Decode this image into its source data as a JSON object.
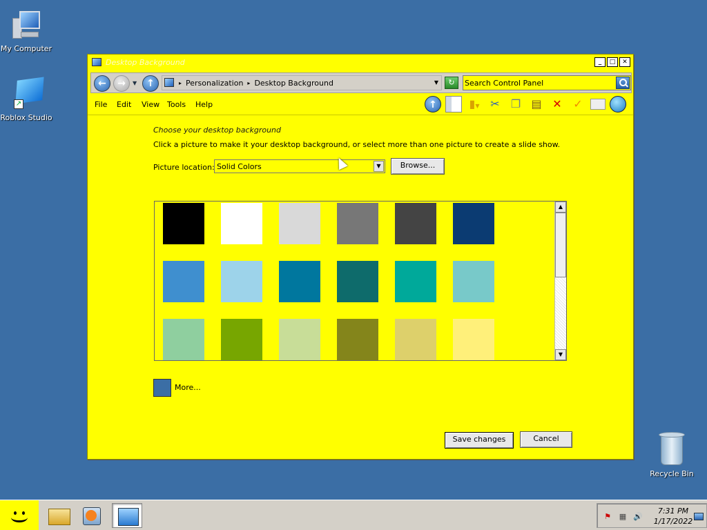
{
  "desktop": {
    "icons": [
      {
        "label": "My Computer"
      },
      {
        "label": "Roblox Studio"
      },
      {
        "label": "Recycle Bin"
      }
    ]
  },
  "window": {
    "title": "Desktop Background",
    "controls": {
      "minimize": "_",
      "maximize": "□",
      "close": "✕"
    },
    "address": {
      "crumbs": [
        "Personalization",
        "Desktop Background"
      ]
    },
    "search": {
      "value": "Search Control Panel"
    },
    "menu": [
      "File",
      "Edit",
      "View",
      "Tools",
      "Help"
    ],
    "toolbar_icons": [
      "up-icon",
      "panes-icon",
      "folders-icon",
      "cut-icon",
      "copy-icon",
      "paste-icon",
      "delete-icon",
      "check-icon",
      "properties-icon",
      "views-icon"
    ]
  },
  "content": {
    "heading": "Choose your desktop background",
    "description": "Click a picture to make it your desktop background, or select more than one picture to create a slide show.",
    "location_label": "Picture location:",
    "location_value": "Solid Colors",
    "browse_label": "Browse...",
    "swatches": [
      "#000000",
      "#ffffff",
      "#d9d9d9",
      "#777777",
      "#444444",
      "#0b3b72",
      "#3f8fcf",
      "#9dd3ea",
      "#00779e",
      "#0e6b6b",
      "#00a99a",
      "#78c9c9",
      "#8fcf9f",
      "#77a600",
      "#c8dd98",
      "#84851b",
      "#ddd06b",
      "#fff07a"
    ],
    "more_label": "More...",
    "more_color": "#3b6ea5",
    "save_label": "Save changes",
    "cancel_label": "Cancel"
  },
  "taskbar": {
    "apps": [
      "explorer-icon",
      "media-player-icon",
      "control-panel-icon"
    ],
    "clock": {
      "time": "7:31 PM",
      "date": "1/17/2022"
    }
  }
}
